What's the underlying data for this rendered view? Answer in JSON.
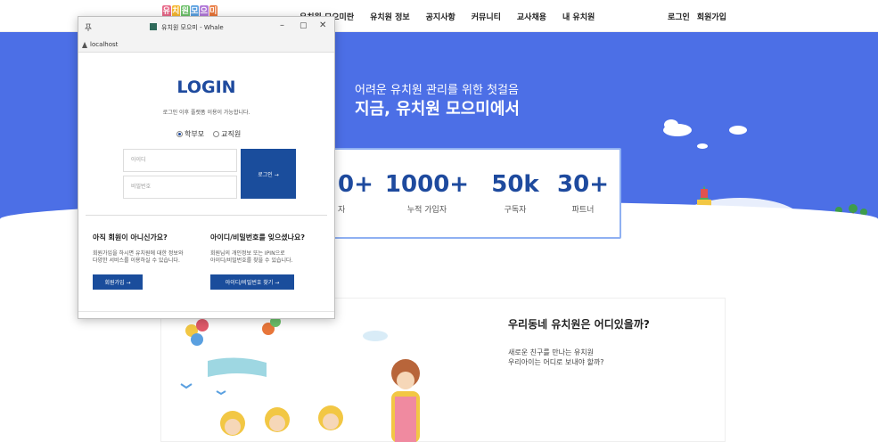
{
  "nav": {
    "logo": [
      "유",
      "치",
      "원",
      "모",
      "으",
      "미"
    ],
    "logo_colors": [
      "#e86a8a",
      "#f5b731",
      "#6cc06a",
      "#5aa0e0",
      "#b27ad8",
      "#e8763a"
    ],
    "menu": [
      "유치원 모으미란",
      "유치원 정보",
      "공지사항",
      "커뮤니티",
      "교사채용",
      "내 유치원"
    ],
    "login": "로그인",
    "signup": "회원가입"
  },
  "hero": {
    "subtitle": "어려운 유치원 관리를 위한 첫걸음",
    "title": "지금, 유치원 모으미에서",
    "stats": [
      {
        "num": "0+",
        "label": "자"
      },
      {
        "num": "1000+",
        "label": "누적 가입자"
      },
      {
        "num": "50k",
        "label": "구독자"
      },
      {
        "num": "30+",
        "label": "파트너"
      }
    ]
  },
  "section": {
    "title": "우리동네 유치원은 어디있을까?",
    "desc1": "새로운 친구를 만나는 유치원",
    "desc2": "우리아이는 어디로 보내야 할까?"
  },
  "popup": {
    "window_title": "유치원 모으미 - Whale",
    "address": "localhost",
    "login_title": "LOGIN",
    "login_desc": "로그인 이후 플랫폼 이용이 가능합니다.",
    "radio_parent": "학부모",
    "radio_teacher": "교직원",
    "id_placeholder": "아이디",
    "pw_placeholder": "비밀번호",
    "login_button": "로그인 →",
    "no_account_title": "아직 회원이 아니신가요?",
    "no_account_desc1": "회원가입을 하시면 유치원에 대한 정보와",
    "no_account_desc2": "다양한 서비스를 이용하실 수 있습니다.",
    "signup_button": "회원가입 →",
    "forgot_title": "아이디/비밀번호를 잊으셨나요?",
    "forgot_desc1": "회원님의 개인정보 또는 IPIN으로",
    "forgot_desc2": "아이디/비밀번호를 찾을 수 있습니다.",
    "find_button": "아이디/비밀번호 찾기 →"
  },
  "colors": {
    "hero_bg": "#4c6fe6",
    "primary": "#1a4d9c",
    "accent_text": "#1e4a9e"
  }
}
